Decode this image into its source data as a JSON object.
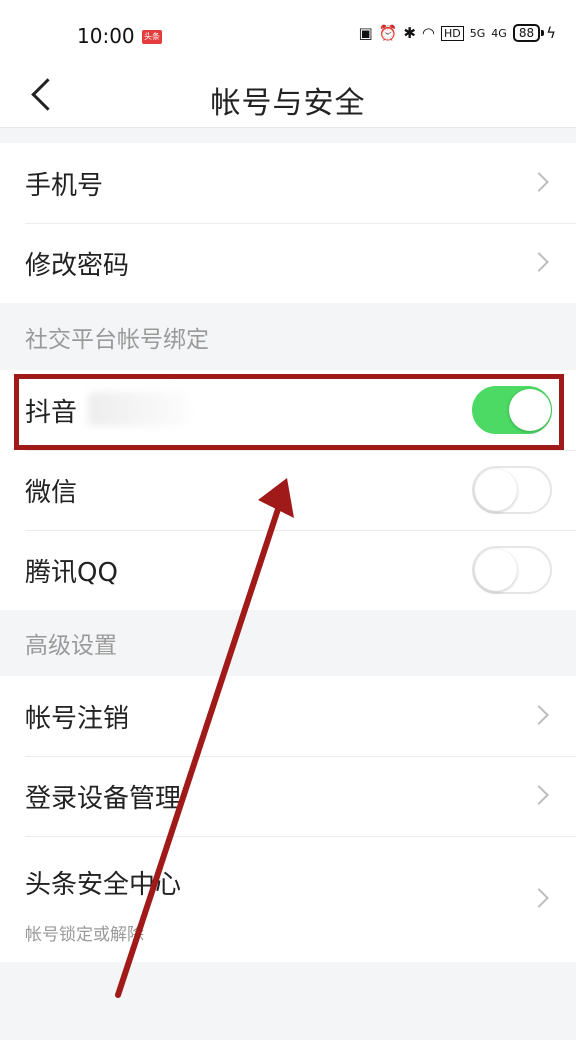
{
  "status_bar": {
    "time": "10:00",
    "app_badge": "头条",
    "network_5g": "5G",
    "network_4g": "4G",
    "hd": "HD",
    "battery": "88"
  },
  "nav": {
    "title": "帐号与安全"
  },
  "account": {
    "phone_label": "手机号",
    "password_label": "修改密码"
  },
  "social": {
    "header": "社交平台帐号绑定",
    "items": [
      {
        "label": "抖音",
        "enabled": true
      },
      {
        "label": "微信",
        "enabled": false
      },
      {
        "label": "腾讯QQ",
        "enabled": false
      }
    ]
  },
  "advanced": {
    "header": "高级设置",
    "deactivate_label": "帐号注销",
    "device_label": "登录设备管理",
    "security_center_label": "头条安全中心",
    "security_center_sub": "帐号锁定或解除"
  },
  "colors": {
    "toggle_on": "#4cd964",
    "annotation": "#a11a1a"
  }
}
